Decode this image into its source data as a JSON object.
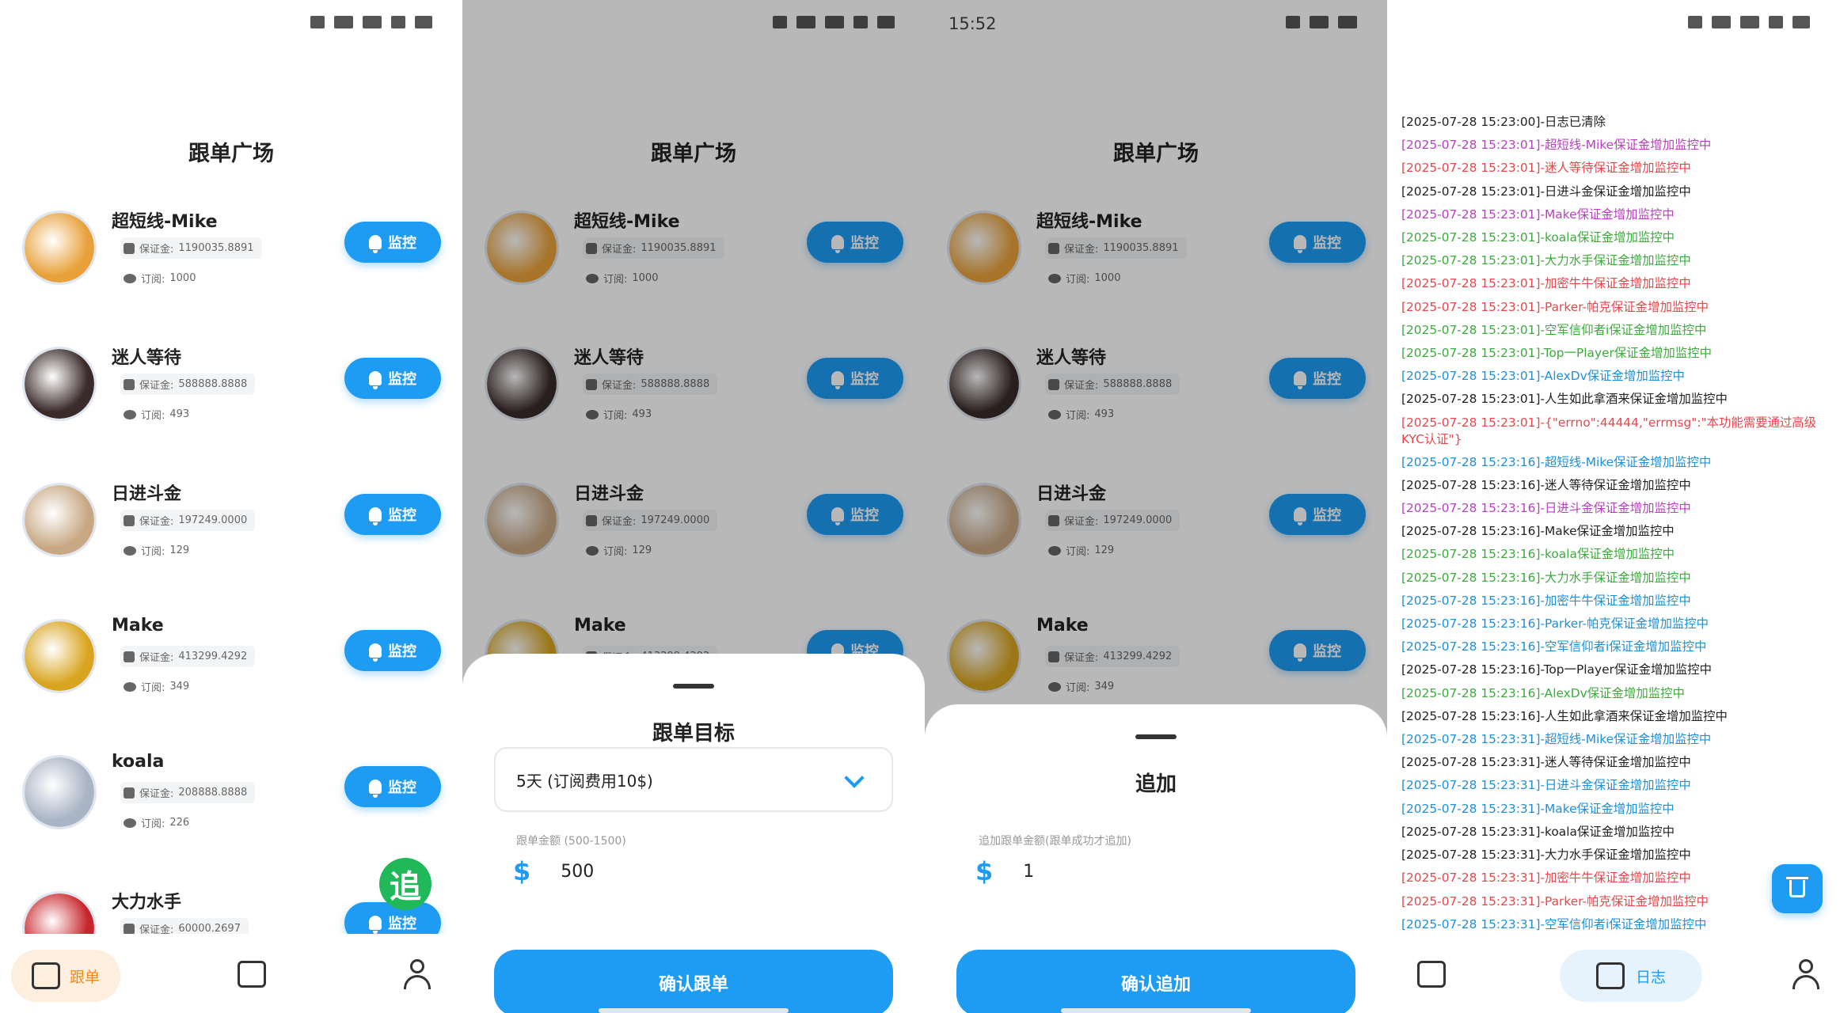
{
  "status": {
    "time_p3": "15:52"
  },
  "list_title": "跟单广场",
  "monitor_label": "监控",
  "margin_prefix": "保证金: ",
  "subs_prefix": "订阅: ",
  "traders": [
    {
      "name": "超短线-Mike",
      "margin": "1190035.8891",
      "subs": "1000",
      "avatar_color": "#e8a13a"
    },
    {
      "name": "迷人等待",
      "margin": "588888.8888",
      "subs": "493",
      "avatar_color": "#3a2a2a"
    },
    {
      "name": "日进斗金",
      "margin": "197249.0000",
      "subs": "129",
      "avatar_color": "#c8a884"
    },
    {
      "name": "Make",
      "margin": "413299.4292",
      "subs": "349",
      "avatar_color": "#d9a520"
    },
    {
      "name": "koala",
      "margin": "208888.8888",
      "subs": "226",
      "avatar_color": "#a9b4c4"
    },
    {
      "name": "大力水手",
      "margin": "60000.2697",
      "subs": "",
      "avatar_color": "#c8262d"
    }
  ],
  "nav": {
    "follow": "跟单",
    "log": "日志"
  },
  "float_chase": "追",
  "sheet_follow": {
    "title": "跟单目标",
    "select_value": "5天 (订阅费用10$)",
    "hint": "跟单金额 (500-1500)",
    "amount": "500",
    "confirm": "确认跟单"
  },
  "sheet_add": {
    "title": "追加",
    "hint": "追加跟单金额(跟单成功才追加)",
    "amount": "1",
    "confirm": "确认追加"
  },
  "currency_symbol": "$",
  "log_lines": [
    {
      "text": "[2025-07-28 15:23:00]-日志已清除",
      "color": "#222222"
    },
    {
      "text": "[2025-07-28 15:23:01]-超短线-Mike保证金增加监控中",
      "color": "#b93fc2"
    },
    {
      "text": "[2025-07-28 15:23:01]-迷人等待保证金增加监控中",
      "color": "#e8464a"
    },
    {
      "text": "[2025-07-28 15:23:01]-日进斗金保证金增加监控中",
      "color": "#222222"
    },
    {
      "text": "[2025-07-28 15:23:01]-Make保证金增加监控中",
      "color": "#b93fc2"
    },
    {
      "text": "[2025-07-28 15:23:01]-koala保证金增加监控中",
      "color": "#3bab3b"
    },
    {
      "text": "[2025-07-28 15:23:01]-大力水手保证金增加监控中",
      "color": "#3bab3b"
    },
    {
      "text": "[2025-07-28 15:23:01]-加密牛牛保证金增加监控中",
      "color": "#e8464a"
    },
    {
      "text": "[2025-07-28 15:23:01]-Parker-帕克保证金增加监控中",
      "color": "#e8464a"
    },
    {
      "text": "[2025-07-28 15:23:01]-空军信仰者i保证金增加监控中",
      "color": "#3bab3b"
    },
    {
      "text": "[2025-07-28 15:23:01]-Top一Player保证金增加监控中",
      "color": "#3bab3b"
    },
    {
      "text": "[2025-07-28 15:23:01]-AlexDv保证金增加监控中",
      "color": "#1e8fd8"
    },
    {
      "text": "[2025-07-28 15:23:01]-人生如此拿酒来保证金增加监控中",
      "color": "#222222"
    },
    {
      "text": "[2025-07-28 15:23:01]-{\"errno\":44444,\"errmsg\":\"本功能需要通过高级KYC认证\"}",
      "color": "#e8464a",
      "wrap": true
    },
    {
      "text": "[2025-07-28 15:23:16]-超短线-Mike保证金增加监控中",
      "color": "#1e8fd8"
    },
    {
      "text": "[2025-07-28 15:23:16]-迷人等待保证金增加监控中",
      "color": "#222222"
    },
    {
      "text": "[2025-07-28 15:23:16]-日进斗金保证金增加监控中",
      "color": "#b93fc2"
    },
    {
      "text": "[2025-07-28 15:23:16]-Make保证金增加监控中",
      "color": "#222222"
    },
    {
      "text": "[2025-07-28 15:23:16]-koala保证金增加监控中",
      "color": "#3bab3b"
    },
    {
      "text": "[2025-07-28 15:23:16]-大力水手保证金增加监控中",
      "color": "#3bab3b"
    },
    {
      "text": "[2025-07-28 15:23:16]-加密牛牛保证金增加监控中",
      "color": "#1e8fd8"
    },
    {
      "text": "[2025-07-28 15:23:16]-Parker-帕克保证金增加监控中",
      "color": "#1e8fd8"
    },
    {
      "text": "[2025-07-28 15:23:16]-空军信仰者i保证金增加监控中",
      "color": "#1e8fd8"
    },
    {
      "text": "[2025-07-28 15:23:16]-Top一Player保证金增加监控中",
      "color": "#222222"
    },
    {
      "text": "[2025-07-28 15:23:16]-AlexDv保证金增加监控中",
      "color": "#3bab3b"
    },
    {
      "text": "[2025-07-28 15:23:16]-人生如此拿酒来保证金增加监控中",
      "color": "#222222"
    },
    {
      "text": "[2025-07-28 15:23:31]-超短线-Mike保证金增加监控中",
      "color": "#1e8fd8"
    },
    {
      "text": "[2025-07-28 15:23:31]-迷人等待保证金增加监控中",
      "color": "#222222"
    },
    {
      "text": "[2025-07-28 15:23:31]-日进斗金保证金增加监控中",
      "color": "#1e8fd8"
    },
    {
      "text": "[2025-07-28 15:23:31]-Make保证金增加监控中",
      "color": "#1e8fd8"
    },
    {
      "text": "[2025-07-28 15:23:31]-koala保证金增加监控中",
      "color": "#222222"
    },
    {
      "text": "[2025-07-28 15:23:31]-大力水手保证金增加监控中",
      "color": "#222222"
    },
    {
      "text": "[2025-07-28 15:23:31]-加密牛牛保证金增加监控中",
      "color": "#e8464a"
    },
    {
      "text": "[2025-07-28 15:23:31]-Parker-帕克保证金增加监控中",
      "color": "#e8464a"
    },
    {
      "text": "[2025-07-28 15:23:31]-空军信仰者i保证金增加监控中",
      "color": "#1e8fd8"
    }
  ],
  "colors": {
    "accent": "#1e9bf3",
    "active_nav_bg": "#fdeede",
    "active_nav_text": "#f08a1c",
    "chase": "#21b85a"
  }
}
